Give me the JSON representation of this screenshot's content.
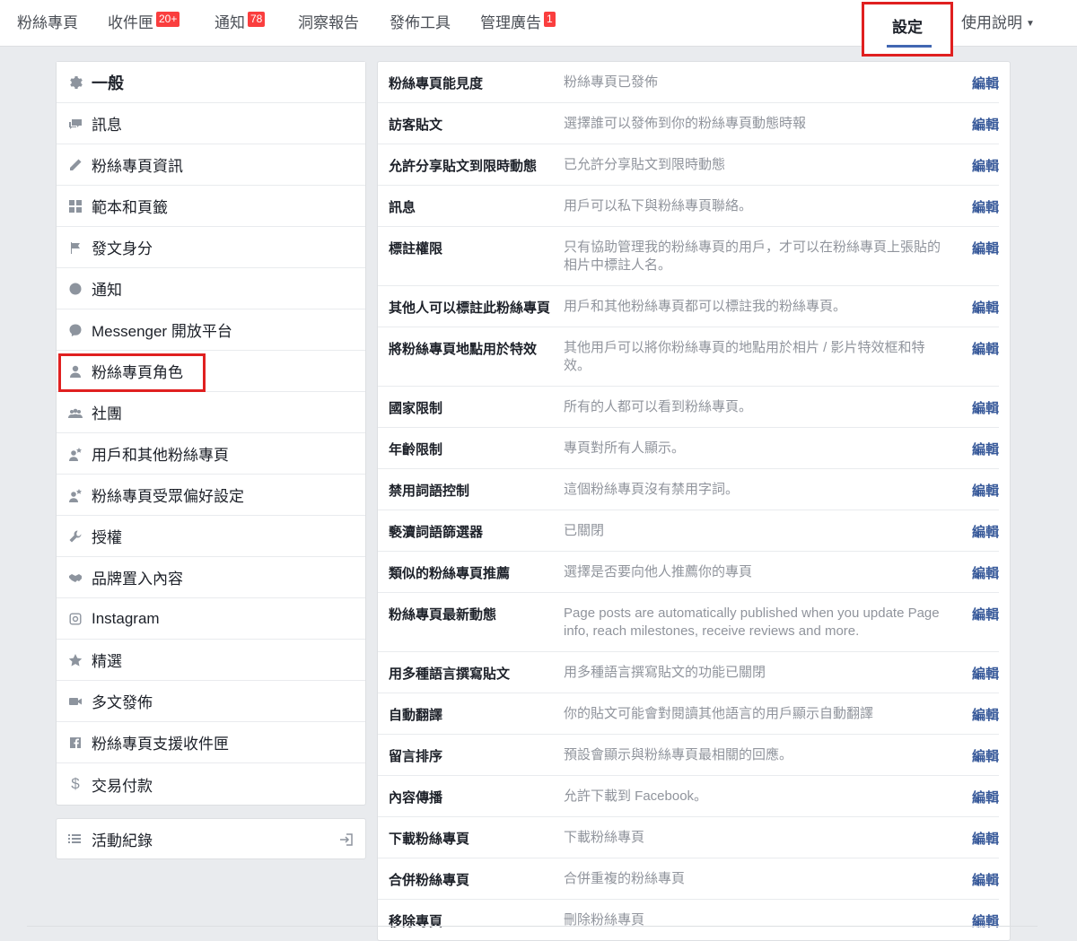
{
  "topnav": {
    "items": [
      {
        "label": "粉絲專頁",
        "badge": ""
      },
      {
        "label": "收件匣",
        "badge": "20+"
      },
      {
        "label": "通知",
        "badge": "78"
      },
      {
        "label": "洞察報告",
        "badge": ""
      },
      {
        "label": "發佈工具",
        "badge": ""
      },
      {
        "label": "管理廣告",
        "badge": "1"
      }
    ],
    "settings_label": "設定",
    "help_label": "使用說明"
  },
  "sidebar": {
    "items": [
      {
        "label": "一般",
        "icon": "gear-icon"
      },
      {
        "label": "訊息",
        "icon": "messages-icon"
      },
      {
        "label": "粉絲專頁資訊",
        "icon": "pencil-icon"
      },
      {
        "label": "範本和頁籤",
        "icon": "grid-icon"
      },
      {
        "label": "發文身分",
        "icon": "flag-icon"
      },
      {
        "label": "通知",
        "icon": "globe-icon"
      },
      {
        "label": "Messenger 開放平台",
        "icon": "messenger-icon"
      },
      {
        "label": "粉絲專頁角色",
        "icon": "person-icon"
      },
      {
        "label": "社團",
        "icon": "group-icon"
      },
      {
        "label": "用戶和其他粉絲專頁",
        "icon": "person-star-icon"
      },
      {
        "label": "粉絲專頁受眾偏好設定",
        "icon": "person-star-icon"
      },
      {
        "label": "授權",
        "icon": "wrench-icon"
      },
      {
        "label": "品牌置入內容",
        "icon": "handshake-icon"
      },
      {
        "label": "Instagram",
        "icon": "instagram-icon"
      },
      {
        "label": "精選",
        "icon": "star-icon"
      },
      {
        "label": "多文發佈",
        "icon": "video-icon"
      },
      {
        "label": "粉絲專頁支援收件匣",
        "icon": "facebook-icon"
      },
      {
        "label": "交易付款",
        "icon": "dollar-icon"
      }
    ],
    "activity_label": "活動紀錄"
  },
  "settings": {
    "edit_label": "編輯",
    "rows": [
      {
        "name": "粉絲專頁能見度",
        "desc": "粉絲專頁已發佈"
      },
      {
        "name": "訪客貼文",
        "desc": "選擇誰可以發佈到你的粉絲專頁動態時報"
      },
      {
        "name": "允許分享貼文到限時動態",
        "desc": "已允許分享貼文到限時動態"
      },
      {
        "name": "訊息",
        "desc": "用戶可以私下與粉絲專頁聯絡。"
      },
      {
        "name": "標註權限",
        "desc": "只有協助管理我的粉絲專頁的用戶，才可以在粉絲專頁上張貼的相片中標註人名。"
      },
      {
        "name": "其他人可以標註此粉絲專頁",
        "desc": "用戶和其他粉絲專頁都可以標註我的粉絲專頁。"
      },
      {
        "name": "將粉絲專頁地點用於特效",
        "desc": "其他用戶可以將你粉絲專頁的地點用於相片 / 影片特效框和特效。"
      },
      {
        "name": "國家限制",
        "desc": "所有的人都可以看到粉絲專頁。"
      },
      {
        "name": "年齡限制",
        "desc": "專頁對所有人顯示。"
      },
      {
        "name": "禁用詞語控制",
        "desc": "這個粉絲專頁沒有禁用字詞。"
      },
      {
        "name": "褻瀆詞語篩選器",
        "desc": "已關閉"
      },
      {
        "name": "類似的粉絲專頁推薦",
        "desc": "選擇是否要向他人推薦你的專頁"
      },
      {
        "name": "粉絲專頁最新動態",
        "desc": "Page posts are automatically published when you update Page info, reach milestones, receive reviews and more."
      },
      {
        "name": "用多種語言撰寫貼文",
        "desc": "用多種語言撰寫貼文的功能已關閉"
      },
      {
        "name": "自動翻譯",
        "desc": "你的貼文可能會對閱讀其他語言的用戶顯示自動翻譯"
      },
      {
        "name": "留言排序",
        "desc": "預設會顯示與粉絲專頁最相關的回應。"
      },
      {
        "name": "內容傳播",
        "desc": "允許下載到 Facebook。"
      },
      {
        "name": "下載粉絲專頁",
        "desc": "下載粉絲專頁"
      },
      {
        "name": "合併粉絲專頁",
        "desc": "合併重複的粉絲專頁"
      },
      {
        "name": "移除專頁",
        "desc": "刪除粉絲專頁"
      }
    ]
  }
}
